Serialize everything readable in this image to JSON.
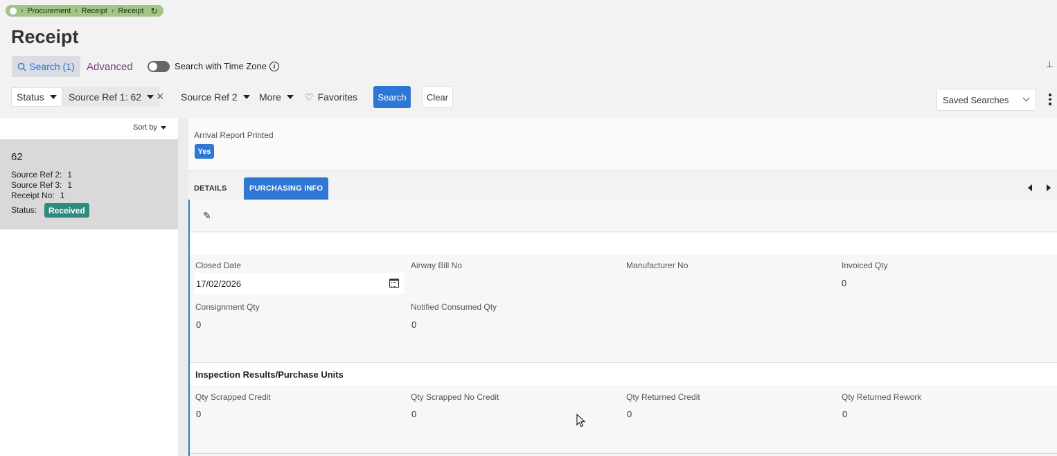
{
  "breadcrumb": {
    "items": [
      "Procurement",
      "Receipt",
      "Receipt"
    ]
  },
  "page": {
    "title": "Receipt"
  },
  "search_bar": {
    "search_tab_label": "Search (1)",
    "advanced_label": "Advanced",
    "timezone_label": "Search with Time Zone"
  },
  "filters": {
    "status_label": "Status",
    "source_ref1_label": "Source Ref 1: 62",
    "source_ref2_label": "Source Ref 2",
    "more_label": "More",
    "favorites_label": "Favorites",
    "search_button": "Search",
    "clear_button": "Clear",
    "saved_searches": "Saved Searches"
  },
  "list": {
    "sort_label": "Sort by",
    "record": {
      "id": "62",
      "source_ref2_label": "Source Ref 2:",
      "source_ref2": "1",
      "source_ref3_label": "Source Ref 3:",
      "source_ref3": "1",
      "receipt_no_label": "Receipt No:",
      "receipt_no": "1",
      "status_label": "Status:",
      "status": "Received"
    }
  },
  "header": {
    "arrival_label": "Arrival Report Printed",
    "arrival_value": "Yes"
  },
  "tabs": {
    "details": "DETAILS",
    "purchasing": "PURCHASING INFO"
  },
  "fields": {
    "closed_date_label": "Closed Date",
    "closed_date": "17/02/2026",
    "airway_label": "Airway Bill No",
    "manufacturer_label": "Manufacturer No",
    "invoiced_label": "Invoiced Qty",
    "invoiced": "0",
    "consignment_label": "Consignment Qty",
    "consignment": "0",
    "notified_label": "Notified Consumed Qty",
    "notified": "0"
  },
  "inspection": {
    "title": "Inspection Results/Purchase Units",
    "scrapped_credit_label": "Qty Scrapped Credit",
    "scrapped_credit": "0",
    "scrapped_nocredit_label": "Qty Scrapped No Credit",
    "scrapped_nocredit": "0",
    "returned_credit_label": "Qty Returned Credit",
    "returned_credit": "0",
    "returned_rework_label": "Qty Returned Rework",
    "returned_rework": "0"
  }
}
